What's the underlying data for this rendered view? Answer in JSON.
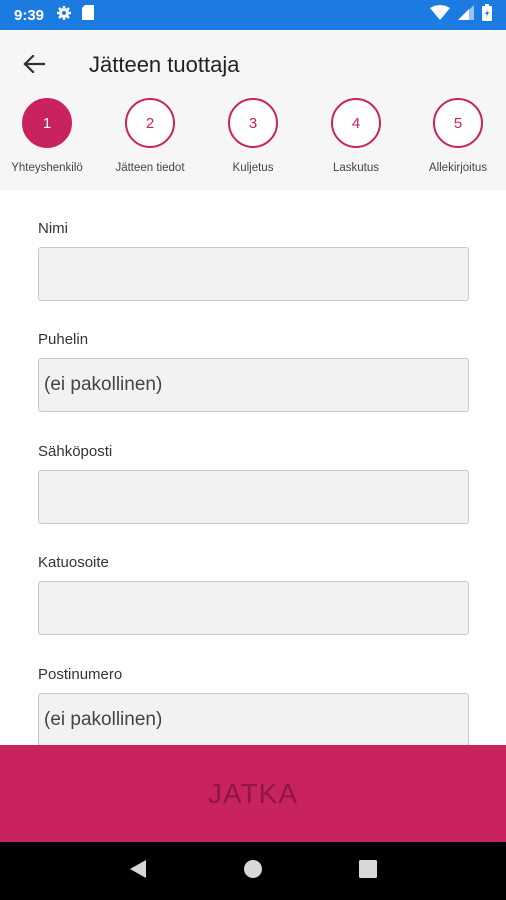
{
  "status_bar": {
    "time": "9:39"
  },
  "header": {
    "title": "Jätteen tuottaja",
    "back_icon": "arrow-left-icon"
  },
  "stepper": {
    "accent_color": "#c8235f",
    "active_step": 1,
    "steps": [
      {
        "number": "1",
        "label": "Yhteyshenkilö"
      },
      {
        "number": "2",
        "label": "Jätteen tiedot"
      },
      {
        "number": "3",
        "label": "Kuljetus"
      },
      {
        "number": "4",
        "label": "Laskutus"
      },
      {
        "number": "5",
        "label": "Allekirjoitus"
      }
    ]
  },
  "form": {
    "fields": [
      {
        "label": "Nimi",
        "value": "",
        "placeholder": ""
      },
      {
        "label": "Puhelin",
        "value": "",
        "placeholder": "(ei pakollinen)"
      },
      {
        "label": "Sähköposti",
        "value": "",
        "placeholder": ""
      },
      {
        "label": "Katuosoite",
        "value": "",
        "placeholder": ""
      },
      {
        "label": "Postinumero",
        "value": "",
        "placeholder": "(ei pakollinen)"
      }
    ]
  },
  "footer": {
    "continue_label": "JATKA"
  },
  "colors": {
    "status_bar": "#1c7be0",
    "accent": "#c8235f"
  }
}
